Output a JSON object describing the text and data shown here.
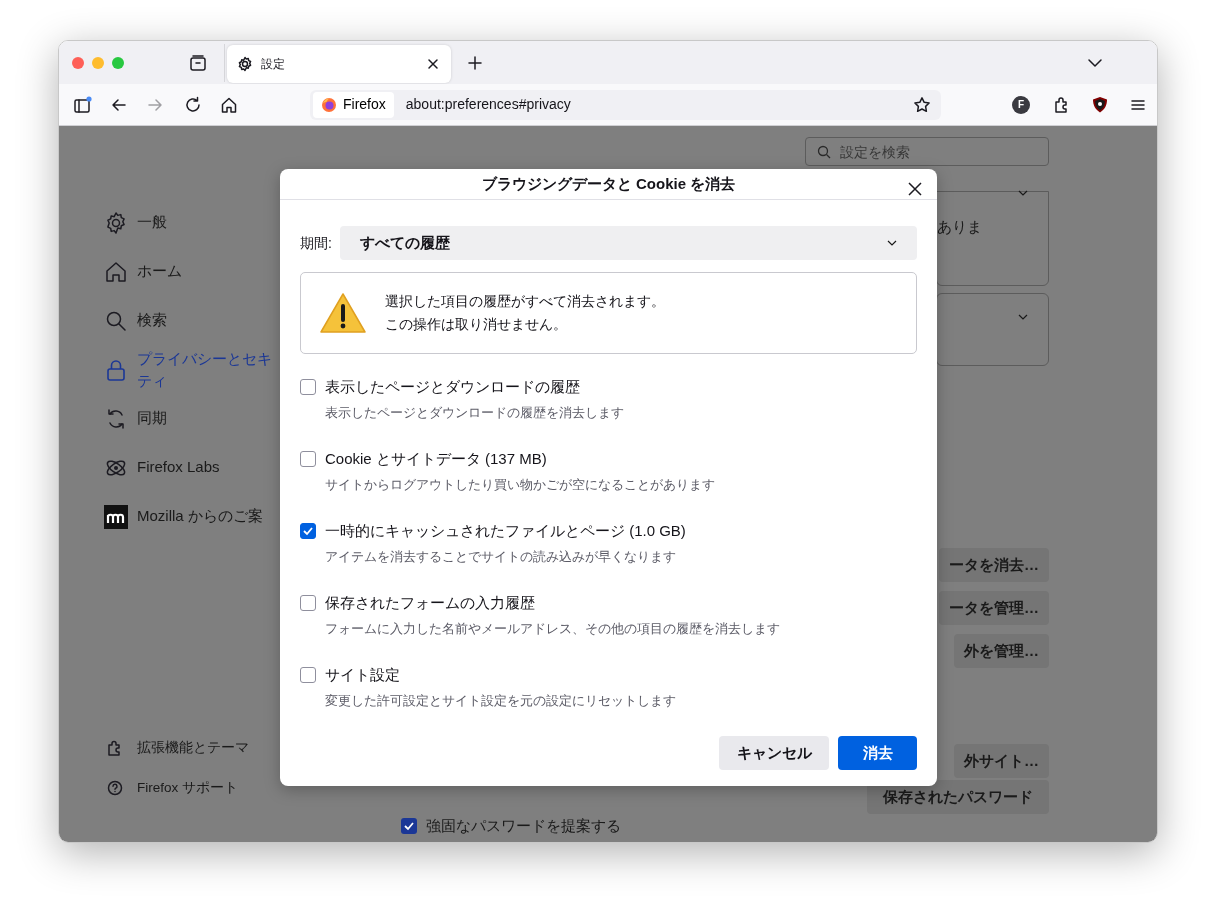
{
  "browser": {
    "tabs": [
      {
        "label": "設定",
        "selected": true
      }
    ],
    "navigation": {
      "back_disabled": false,
      "forward_disabled": true
    },
    "url_bar": {
      "identity": "Firefox",
      "url": "about:preferences#privacy"
    },
    "profile_initial": "F"
  },
  "page": {
    "search": {
      "placeholder": "設定を検索"
    },
    "sidebar": {
      "items": [
        {
          "kind": "general",
          "label_lines": [
            "一般"
          ],
          "selected": false
        },
        {
          "kind": "home",
          "label_lines": [
            "ホーム"
          ],
          "selected": false
        },
        {
          "kind": "search",
          "label_lines": [
            "検索"
          ],
          "selected": false
        },
        {
          "kind": "privacy",
          "label_lines": [
            "プライバシーとセキ",
            "ティ"
          ],
          "selected": true
        },
        {
          "kind": "sync",
          "label_lines": [
            "同期"
          ],
          "selected": false
        },
        {
          "kind": "labs",
          "label_lines": [
            "Firefox Labs"
          ],
          "selected": false
        },
        {
          "kind": "mozilla",
          "label_lines": [
            "Mozilla からのご案"
          ],
          "selected": false
        }
      ],
      "footer_links": [
        {
          "kind": "extensions",
          "label": "拡張機能とテーマ"
        },
        {
          "kind": "help",
          "label": "Firefox サポート"
        }
      ]
    },
    "cards": [
      {
        "kind": "text",
        "text": "ありま"
      },
      {
        "kind": "empty"
      }
    ],
    "buttons_upper": [
      "ータを消去…",
      "ータを管理…",
      "外を管理…"
    ],
    "buttons_lower": [
      "外サイト…",
      "保存されたパスワード"
    ],
    "checkbox": {
      "label": "強固なパスワードを提案する",
      "checked": true
    }
  },
  "dialog": {
    "title": "ブラウジングデータと Cookie を消去",
    "period_label": "期間:",
    "period_value": "すべての履歴",
    "warning_lines": [
      "選択した項目の履歴がすべて消去されます。",
      "この操作は取り消せません。"
    ],
    "options": [
      {
        "label": "表示したページとダウンロードの履歴",
        "description": "表示したページとダウンロードの履歴を消去します",
        "checked": false
      },
      {
        "label": "Cookie とサイトデータ (137 MB)",
        "description": "サイトからログアウトしたり買い物かごが空になることがあります",
        "checked": false
      },
      {
        "label": "一時的にキャッシュされたファイルとページ (1.0 GB)",
        "description": "アイテムを消去することでサイトの読み込みが早くなります",
        "checked": true
      },
      {
        "label": "保存されたフォームの入力履歴",
        "description": "フォームに入力した名前やメールアドレス、その他の項目の履歴を消去します",
        "checked": false
      },
      {
        "label": "サイト設定",
        "description": "変更した許可設定とサイト設定を元の設定にリセットします",
        "checked": false
      }
    ],
    "buttons": [
      {
        "label": "キャンセル",
        "kind": "secondary"
      },
      {
        "label": "消去",
        "kind": "primary"
      }
    ]
  }
}
